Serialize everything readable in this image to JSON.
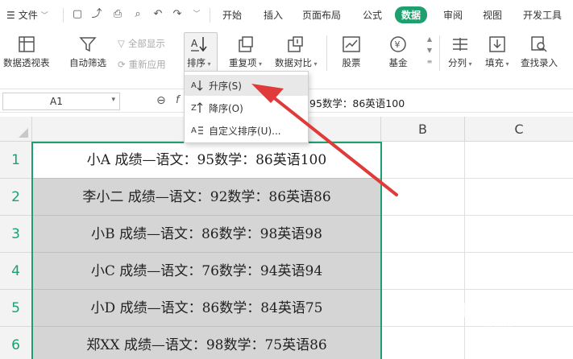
{
  "menubar": {
    "file": "文件",
    "tabs": [
      "开始",
      "插入",
      "页面布局",
      "公式",
      "数据",
      "审阅",
      "视图",
      "开发工具"
    ],
    "active_tab": "数据",
    "accent": "#1e9f6e"
  },
  "ribbon": {
    "pivot": "数据透视表",
    "autofilter": "自动筛选",
    "show_all": "全部显示",
    "reapply": "重新应用",
    "sort": "排序",
    "duplicates": "重复项",
    "compare": "数据对比",
    "stock": "股票",
    "fund": "基金",
    "split": "分列",
    "fill": "填充",
    "find_entry": "查找录入"
  },
  "formula_bar": {
    "cell_ref": "A1",
    "value_visible": "95数学：86英语100"
  },
  "sort_menu": {
    "items": [
      "升序(S)",
      "降序(O)",
      "自定义排序(U)..."
    ]
  },
  "grid": {
    "columns": [
      "B",
      "C"
    ],
    "rows": [
      {
        "num": "1",
        "a": "小A 成绩—语文：95数学：86英语100"
      },
      {
        "num": "2",
        "a": "李小二 成绩—语文：92数学：86英语86"
      },
      {
        "num": "3",
        "a": "小B 成绩—语文：86数学：98英语98"
      },
      {
        "num": "4",
        "a": "小C 成绩—语文：76数学：94英语94"
      },
      {
        "num": "5",
        "a": "小D 成绩—语文：86数学：84英语75"
      },
      {
        "num": "6",
        "a": "郑XX 成绩—语文：98数学：75英语86"
      }
    ]
  },
  "watermark": {
    "text": "Bai du",
    "sub": "jingyan"
  }
}
